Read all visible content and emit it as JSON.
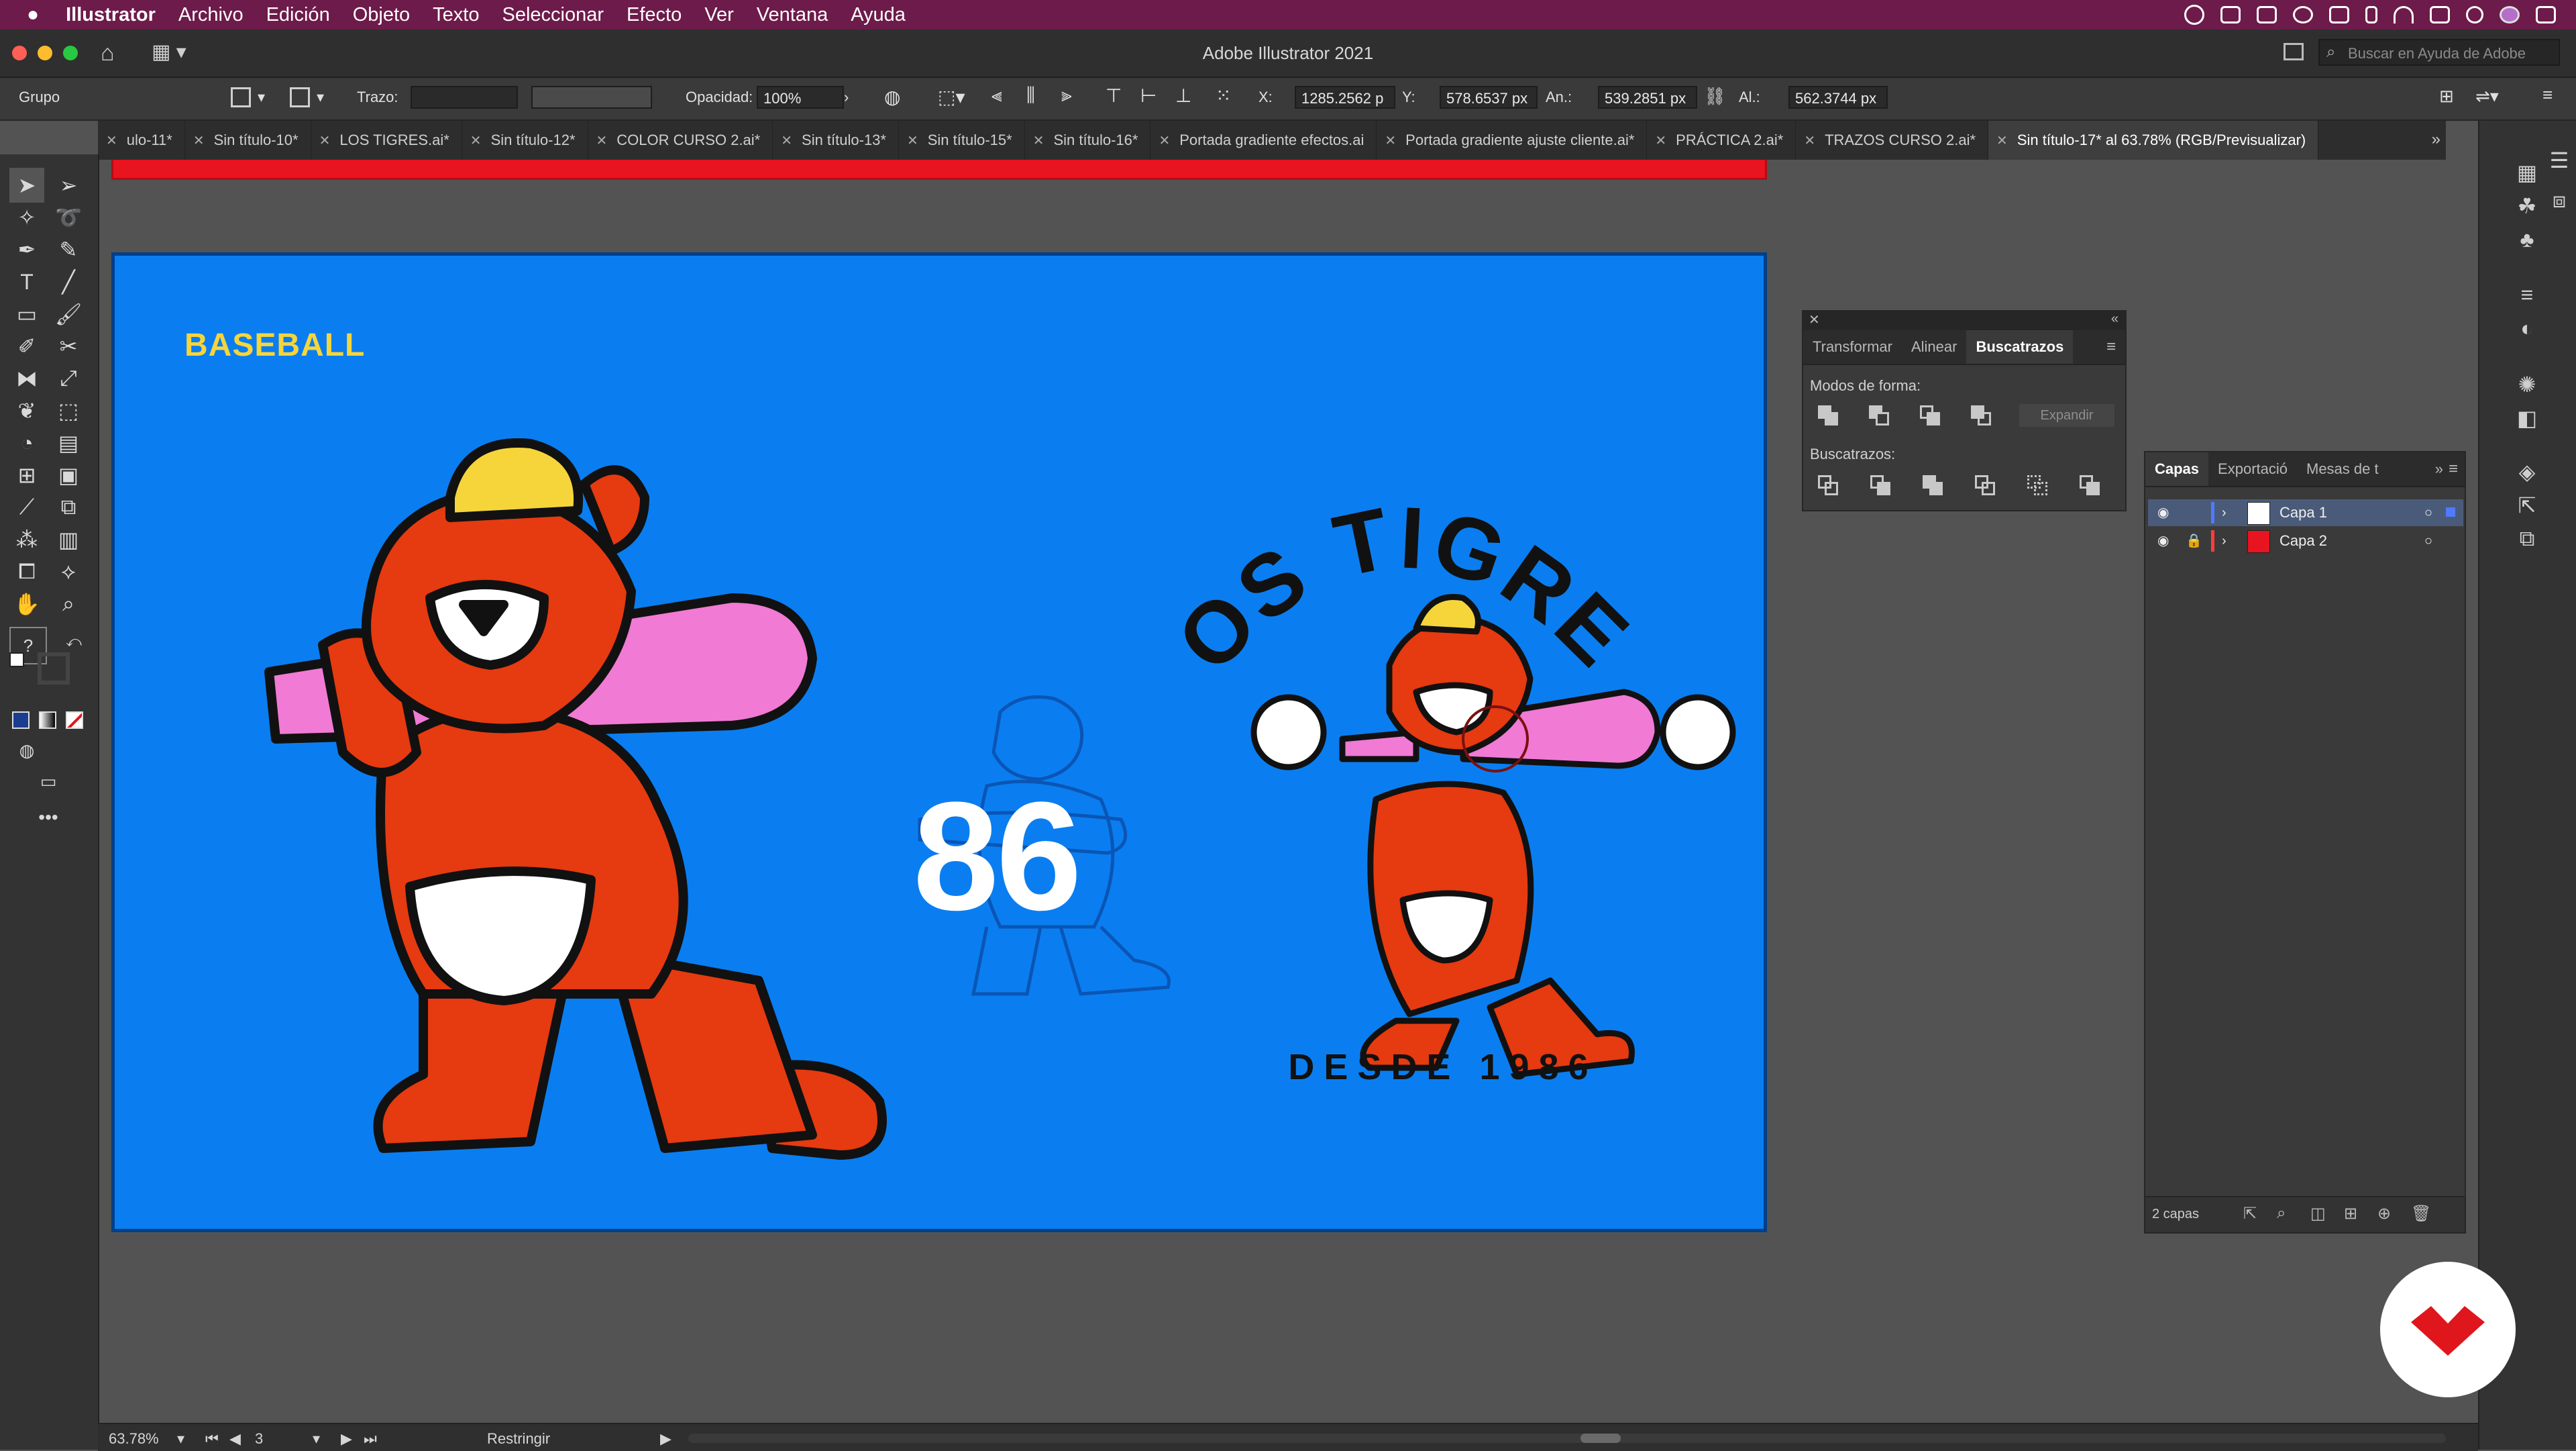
{
  "menubar": {
    "app_name": "Illustrator",
    "items": [
      "Archivo",
      "Edición",
      "Objeto",
      "Texto",
      "Seleccionar",
      "Efecto",
      "Ver",
      "Ventana",
      "Ayuda"
    ]
  },
  "window": {
    "title": "Adobe Illustrator 2021",
    "search_placeholder": "Buscar en Ayuda de Adobe"
  },
  "control_bar": {
    "selection_type": "Grupo",
    "stroke_label": "Trazo:",
    "opacity_label": "Opacidad:",
    "opacity_value": "100%",
    "x_label": "X:",
    "x_value": "1285.2562 p",
    "y_label": "Y:",
    "y_value": "578.6537 px",
    "w_label": "An.:",
    "w_value": "539.2851 px",
    "h_label": "Al.:",
    "h_value": "562.3744 px"
  },
  "tabs": [
    {
      "label": "ulo-11*",
      "active": false
    },
    {
      "label": "Sin título-10*",
      "active": false
    },
    {
      "label": "LOS TIGRES.ai*",
      "active": false
    },
    {
      "label": "Sin título-12*",
      "active": false
    },
    {
      "label": "COLOR CURSO 2.ai*",
      "active": false
    },
    {
      "label": "Sin título-13*",
      "active": false
    },
    {
      "label": "Sin título-15*",
      "active": false
    },
    {
      "label": "Sin título-16*",
      "active": false
    },
    {
      "label": "Portada gradiente efectos.ai",
      "active": false
    },
    {
      "label": "Portada gradiente ajuste cliente.ai*",
      "active": false
    },
    {
      "label": "PRÁCTICA 2.ai*",
      "active": false
    },
    {
      "label": "TRAZOS CURSO 2.ai*",
      "active": false
    },
    {
      "label": "Sin título-17* al 63.78% (RGB/Previsualizar)",
      "active": true
    }
  ],
  "artwork": {
    "corner_text": "BASEBALL",
    "arc_text": "LOS TIGRES",
    "number": "86",
    "tagline": "DESDE 1986",
    "colors": {
      "background": "#0a7ef0",
      "tiger": "#e63a10",
      "cap": "#f6d53b",
      "bat": "#f07ad4",
      "outline": "#111111"
    }
  },
  "pathfinder_panel": {
    "tabs": [
      "Transformar",
      "Alinear",
      "Buscatrazos"
    ],
    "active_tab": "Buscatrazos",
    "shape_modes_label": "Modos de forma:",
    "expand_label": "Expandir",
    "pathfinders_label": "Buscatrazos:"
  },
  "layers_panel": {
    "tabs": [
      "Capas",
      "Exportació",
      "Mesas de t"
    ],
    "active_tab": "Capas",
    "layers": [
      {
        "name": "Capa 1",
        "color": "#4f7bff",
        "locked": false
      },
      {
        "name": "Capa 2",
        "color": "#ff3d3d",
        "locked": true
      }
    ],
    "count": "2 capas"
  },
  "status_bar": {
    "zoom": "63.78%",
    "artboard_number": "3",
    "mode": "Restringir"
  }
}
